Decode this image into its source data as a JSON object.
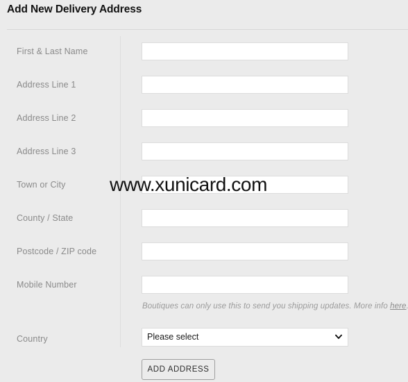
{
  "header": {
    "title": "Add New Delivery Address"
  },
  "form": {
    "fields": [
      {
        "label": "First & Last Name",
        "value": "",
        "name": "first-last-name"
      },
      {
        "label": "Address Line 1",
        "value": "",
        "name": "address-line-1"
      },
      {
        "label": "Address Line 2",
        "value": "",
        "name": "address-line-2"
      },
      {
        "label": "Address Line 3",
        "value": "",
        "name": "address-line-3"
      },
      {
        "label": "Town or City",
        "value": "",
        "name": "town-or-city"
      },
      {
        "label": "County / State",
        "value": "",
        "name": "county-state"
      },
      {
        "label": "Postcode / ZIP code",
        "value": "",
        "name": "postcode-zip"
      },
      {
        "label": "Mobile Number",
        "value": "",
        "name": "mobile-number"
      }
    ],
    "mobile_helper": {
      "text": "Boutiques can only use this to send you shipping updates. More info ",
      "link_label": "here",
      "suffix": "."
    },
    "country": {
      "label": "Country",
      "selected": "Please select",
      "options": [
        "Please select"
      ]
    },
    "submit_label": "ADD ADDRESS"
  },
  "watermark": {
    "text": "www.xunicard.com"
  },
  "colors": {
    "background": "#ebebeb",
    "label": "#8a8a8a",
    "title": "#111111",
    "input_border": "#dcdcdc",
    "divider": "#dedede"
  }
}
